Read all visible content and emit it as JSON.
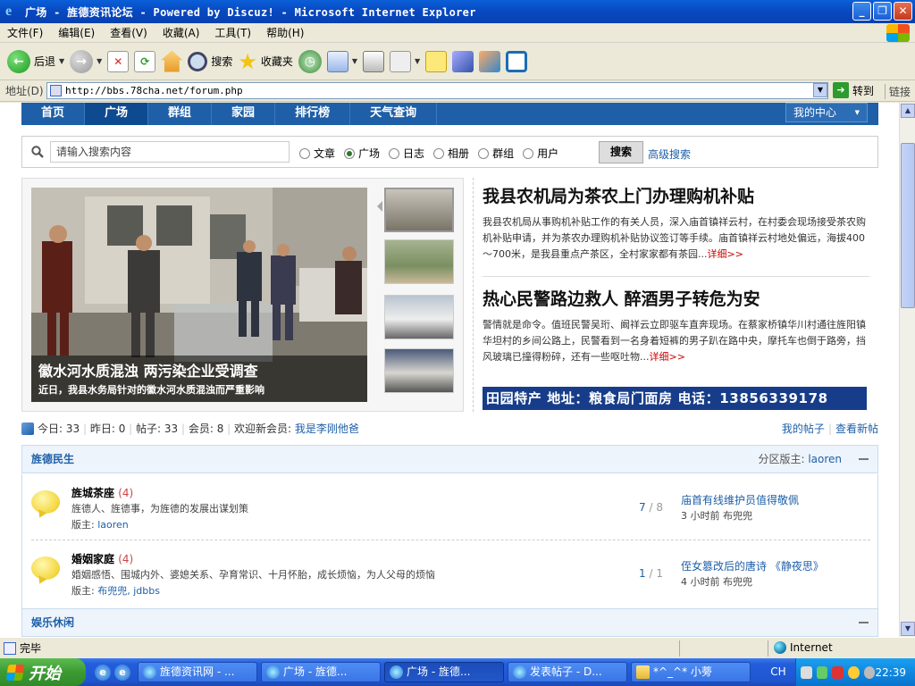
{
  "window": {
    "title": "广场 - 旌德资讯论坛 - Powered by Discuz! - Microsoft Internet Explorer"
  },
  "menu": [
    "文件(F)",
    "编辑(E)",
    "查看(V)",
    "收藏(A)",
    "工具(T)",
    "帮助(H)"
  ],
  "toolbar": {
    "back": "后退",
    "search": "搜索",
    "favorites": "收藏夹"
  },
  "address": {
    "label": "地址(D)",
    "url": "http://bbs.78cha.net/forum.php",
    "go": "转到",
    "links": "链接"
  },
  "nav": {
    "items": [
      "首页",
      "广场",
      "群组",
      "家园",
      "排行榜",
      "天气查询"
    ],
    "center": "我的中心"
  },
  "search": {
    "placeholder": "请输入搜索内容",
    "options": [
      "文章",
      "广场",
      "日志",
      "相册",
      "群组",
      "用户"
    ],
    "button": "搜索",
    "advanced": "高级搜索"
  },
  "slide": {
    "title": "徽水河水质混浊 两污染企业受调查",
    "subtitle": "近日，我县水务局针对的徽水河水质混浊而严重影响"
  },
  "articles": [
    {
      "title": "我县农机局为茶农上门办理购机补贴",
      "text": "我县农机局从事购机补贴工作的有关人员，深入庙首镇祥云村，在村委会现场接受茶农购机补贴申请，并为茶农办理购机补贴协议签订等手续。庙首镇祥云村地处偏远，海拔400～700米，是我县重点产茶区，全村家家都有茶园...",
      "more": "详细>>"
    },
    {
      "title": "热心民警路边救人 醉酒男子转危为安",
      "text": "警情就是命令。值班民警吴珩、阚祥云立即驱车直奔现场。在蔡家桥镇华川村通往旌阳镇华坦村的乡间公路上，民警看到一名身着短裤的男子趴在路中央，摩托车也倒于路旁，挡风玻璃已撞得粉碎，还有一些呕吐物...",
      "more": "详细>>"
    }
  ],
  "banner": {
    "text": "田园特产 地址：粮食局门面房 电话：",
    "phone": "13856339178"
  },
  "stats": {
    "today_label": "今日:",
    "today": "33",
    "yesterday_label": "昨日:",
    "yesterday": "0",
    "posts_label": "帖子:",
    "posts": "33",
    "members_label": "会员:",
    "members": "8",
    "welcome": "欢迎新会员:",
    "newest": "我是李刚他爸",
    "my_posts": "我的帖子",
    "new_posts": "查看新帖"
  },
  "categories": [
    {
      "name": "旌德民生",
      "mod_label": "分区版主:",
      "mod": "laoren"
    },
    {
      "name": "娱乐休闲"
    }
  ],
  "forums": [
    {
      "name": "旌城茶座",
      "count": "(4)",
      "desc": "旌德人、旌德事，为旌德的发展出谋划策",
      "mod_label": "版主:",
      "mods": "laoren",
      "threads": "7",
      "total": "8",
      "last_title": "庙首有线维护员值得敬佩",
      "last_meta": "3 小时前 布兜兜"
    },
    {
      "name": "婚姻家庭",
      "count": "(4)",
      "desc": "婚姻感悟、围城内外、婆媳关系、孕育常识、十月怀胎，成长烦恼，为人父母的烦恼",
      "mod_label": "版主:",
      "mods": "布兜兜, jdbbs",
      "threads": "1",
      "total": "1",
      "last_title": "侄女篡改后的唐诗 《静夜思》",
      "last_meta": "4 小时前 布兜兜"
    }
  ],
  "status": {
    "text": "完毕",
    "zone": "Internet"
  },
  "taskbar": {
    "start": "开始",
    "tasks": [
      "旌德资讯网 - ...",
      "广场 - 旌德...",
      "广场 - 旌德...",
      "发表帖子 - D...",
      "*^_^* 小蒡"
    ],
    "lang": "CH",
    "clock": "22:39"
  }
}
